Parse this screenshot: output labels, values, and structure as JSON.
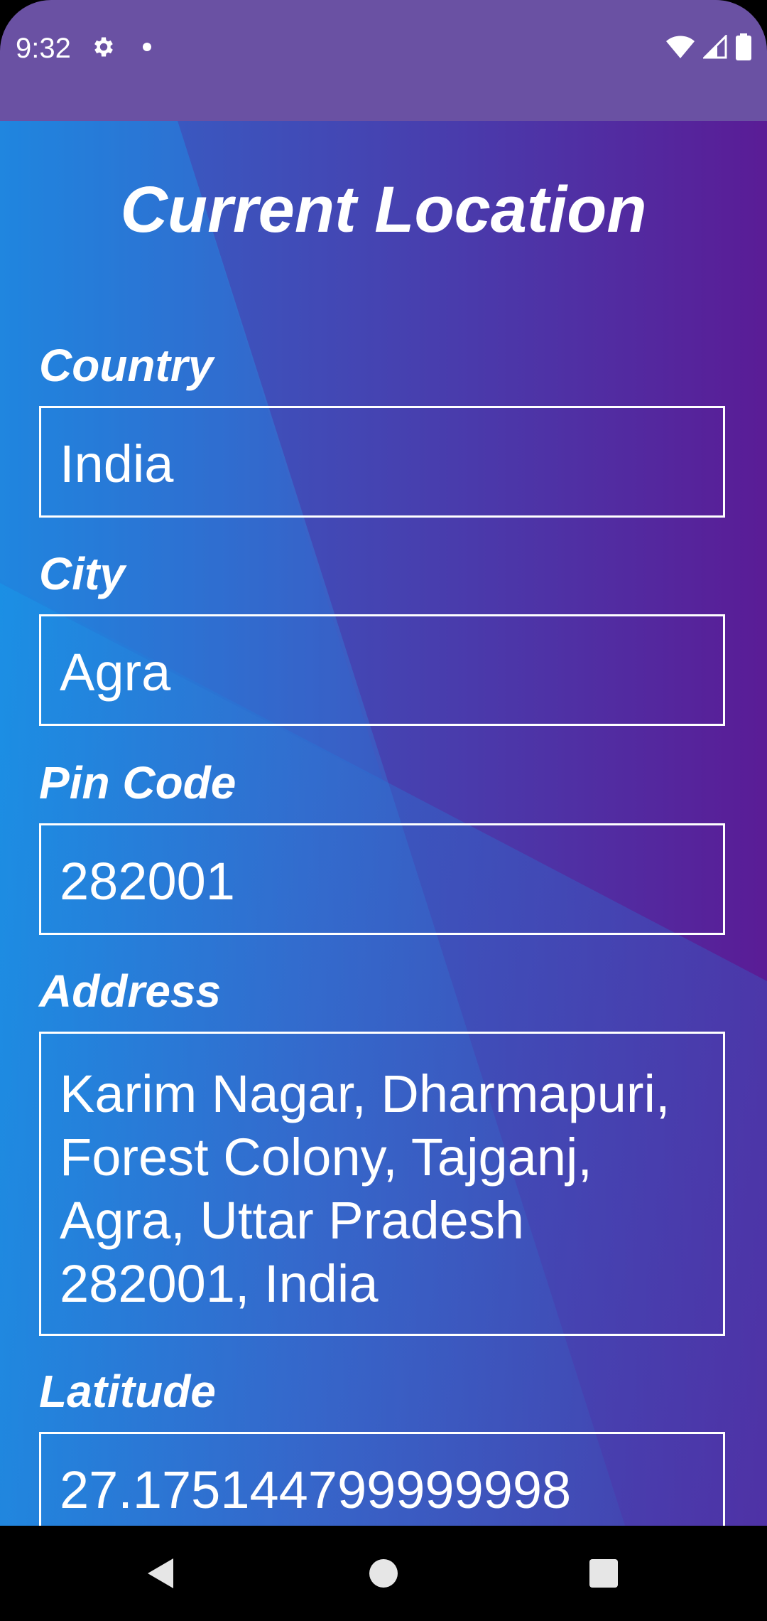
{
  "status_bar": {
    "time": "9:32",
    "icons": [
      "settings-gear-icon",
      "notification-dot-icon",
      "wifi-icon",
      "cell-signal-icon",
      "battery-icon"
    ],
    "background": "#6a51a3"
  },
  "header": {
    "title": "Current Location"
  },
  "fields": {
    "country": {
      "label": "Country",
      "value": "India"
    },
    "city": {
      "label": "City",
      "value": "Agra"
    },
    "pin_code": {
      "label": "Pin Code",
      "value": "282001"
    },
    "address": {
      "label": "Address",
      "value": "Karim Nagar, Dharmapuri, Forest Colony, Tajganj, Agra, Uttar Pradesh 282001, India"
    },
    "latitude": {
      "label": "Latitude",
      "value": "27.175144799999998"
    }
  },
  "theme": {
    "gradient_start": "#2a7ed8",
    "gradient_end": "#561b98",
    "text_color": "#ffffff"
  },
  "nav_bar": {
    "buttons": [
      "back-icon",
      "home-icon",
      "recents-icon"
    ]
  }
}
